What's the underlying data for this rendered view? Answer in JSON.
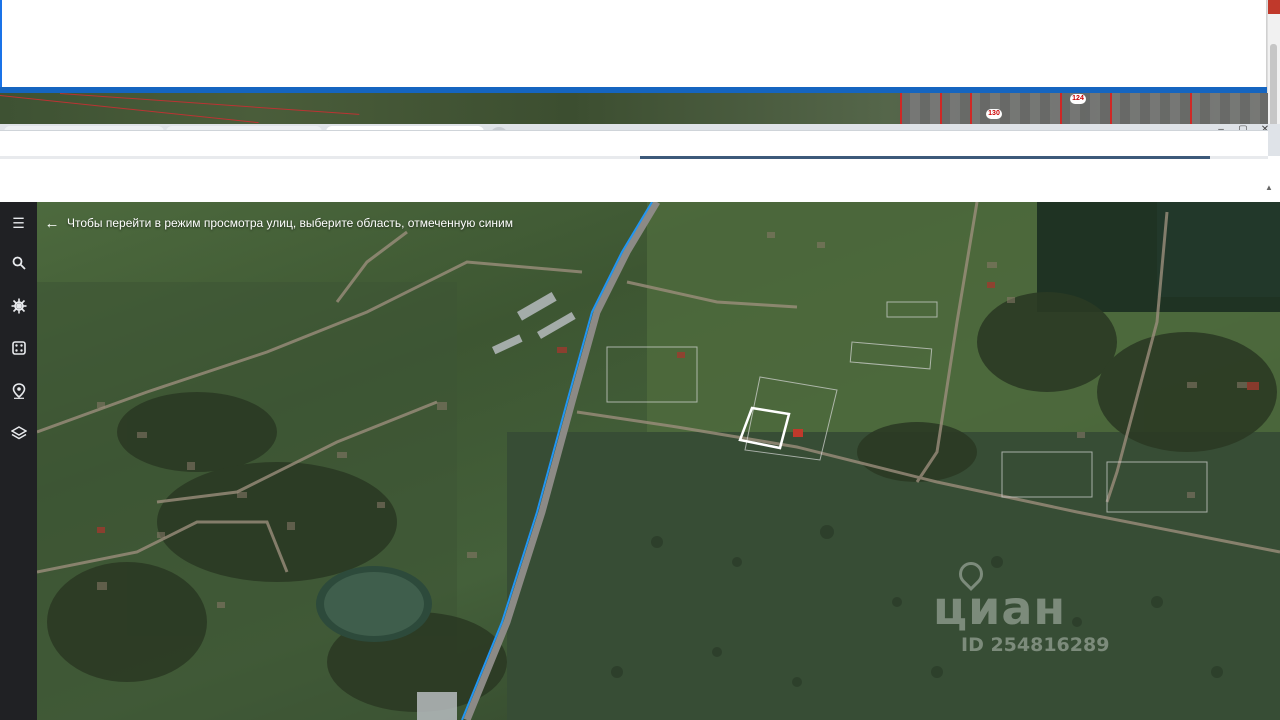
{
  "map": {
    "street_view_hint": "Чтобы перейти в режим просмотра улиц, выберите область, отмеченную синим",
    "back_icon": "arrow-left-icon"
  },
  "sidebar": {
    "items": [
      {
        "name": "menu",
        "icon": "menu-icon"
      },
      {
        "name": "search",
        "icon": "search-icon"
      },
      {
        "name": "voyager",
        "icon": "ship-wheel-icon"
      },
      {
        "name": "feeling-lucky",
        "icon": "dice-icon"
      },
      {
        "name": "projects",
        "icon": "map-pin-icon"
      },
      {
        "name": "map-style",
        "icon": "layers-icon"
      }
    ]
  },
  "background_map": {
    "labels": [
      "130",
      "124"
    ]
  },
  "watermark": {
    "brand": "циан",
    "listing_id": "ID 254816289"
  },
  "colors": {
    "accent_blue": "#1565c0",
    "sidebar_bg": "#202124",
    "road_blue": "#2196f3"
  }
}
